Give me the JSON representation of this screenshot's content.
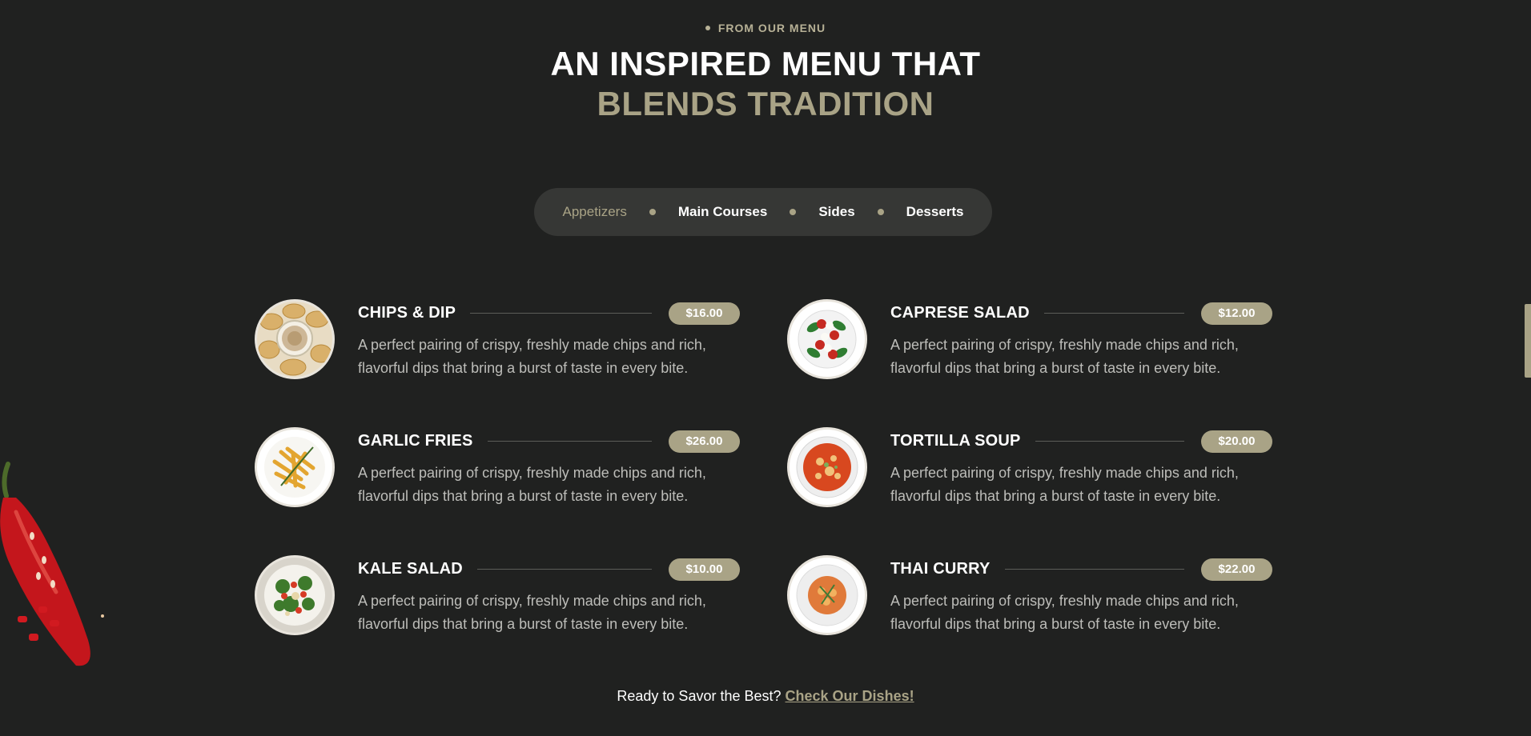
{
  "header": {
    "eyebrow": "FROM OUR MENU",
    "title_line1": "AN INSPIRED MENU THAT",
    "title_line2": "BLENDS TRADITION"
  },
  "tabs": [
    {
      "label": "Appetizers",
      "active": true
    },
    {
      "label": "Main Courses",
      "active": false
    },
    {
      "label": "Sides",
      "active": false
    },
    {
      "label": "Desserts",
      "active": false
    }
  ],
  "menu": [
    {
      "name": "CHIPS & DIP",
      "price": "$16.00",
      "description": "A perfect pairing of crispy, freshly made chips and rich, flavorful dips that bring a burst of taste in every bite.",
      "icon": "chips-dip-image"
    },
    {
      "name": "CAPRESE SALAD",
      "price": "$12.00",
      "description": "A perfect pairing of crispy, freshly made chips and rich, flavorful dips that bring a burst of taste in every bite.",
      "icon": "caprese-salad-image"
    },
    {
      "name": "GARLIC FRIES",
      "price": "$26.00",
      "description": "A perfect pairing of crispy, freshly made chips and rich, flavorful dips that bring a burst of taste in every bite.",
      "icon": "garlic-fries-image"
    },
    {
      "name": "TORTILLA SOUP",
      "price": "$20.00",
      "description": "A perfect pairing of crispy, freshly made chips and rich, flavorful dips that bring a burst of taste in every bite.",
      "icon": "tortilla-soup-image"
    },
    {
      "name": "KALE SALAD",
      "price": "$10.00",
      "description": "A perfect pairing of crispy, freshly made chips and rich, flavorful dips that bring a burst of taste in every bite.",
      "icon": "kale-salad-image"
    },
    {
      "name": "THAI CURRY",
      "price": "$22.00",
      "description": "A perfect pairing of crispy, freshly made chips and rich, flavorful dips that bring a burst of taste in every bite.",
      "icon": "thai-curry-image"
    }
  ],
  "cta": {
    "text": "Ready to Savor the Best?",
    "link_label": "Check Our Dishes!"
  },
  "colors": {
    "background": "#202120",
    "accent": "#a9a386",
    "tab_bar": "#363735"
  }
}
